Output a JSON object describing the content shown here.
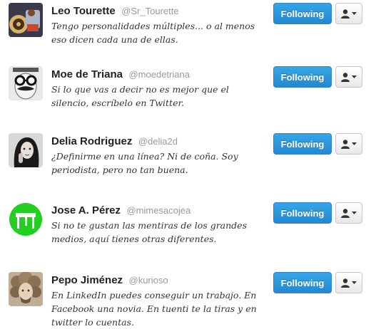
{
  "colors": {
    "follow_button": "#2e9ae0",
    "name_text": "#222222",
    "screen_name_text": "#999999",
    "bio_text": "#333333"
  },
  "users": [
    {
      "full_name": "Leo Tourette",
      "screen_name": "@Sr_Tourette",
      "bio": "Tengo personalidades múltiples... o al menos eso dicen cada una de ellas.",
      "follow_label": "Following",
      "avatar_icon": "cartoon-character-avatar"
    },
    {
      "full_name": "Moe de Triana",
      "screen_name": "@moedetriana",
      "bio": "Si lo que vas a decir no es mejor que el silencio, escríbelo en Twitter.",
      "follow_label": "Following",
      "avatar_icon": "glasses-mustache-avatar"
    },
    {
      "full_name": "Delia Rodriguez",
      "screen_name": "@delia2d",
      "bio": "¿Definirme en una línea? Ni de coña. Soy periodista, pero no tan buena.",
      "follow_label": "Following",
      "avatar_icon": "woman-portrait-avatar"
    },
    {
      "full_name": "Jose A. Pérez",
      "screen_name": "@mimesacojea",
      "bio": "Si no te gustan las mentiras de los grandes medios, aquí tienes otras diferentes.",
      "follow_label": "Following",
      "avatar_icon": "green-table-avatar"
    },
    {
      "full_name": "Pepo Jiménez",
      "screen_name": "@kurioso",
      "bio": "En LinkedIn puedes conseguir un trabajo. En Facebook una novia. En tuenti te la tiras y en twitter lo cuentas.",
      "follow_label": "Following",
      "avatar_icon": "curly-hair-avatar"
    }
  ]
}
